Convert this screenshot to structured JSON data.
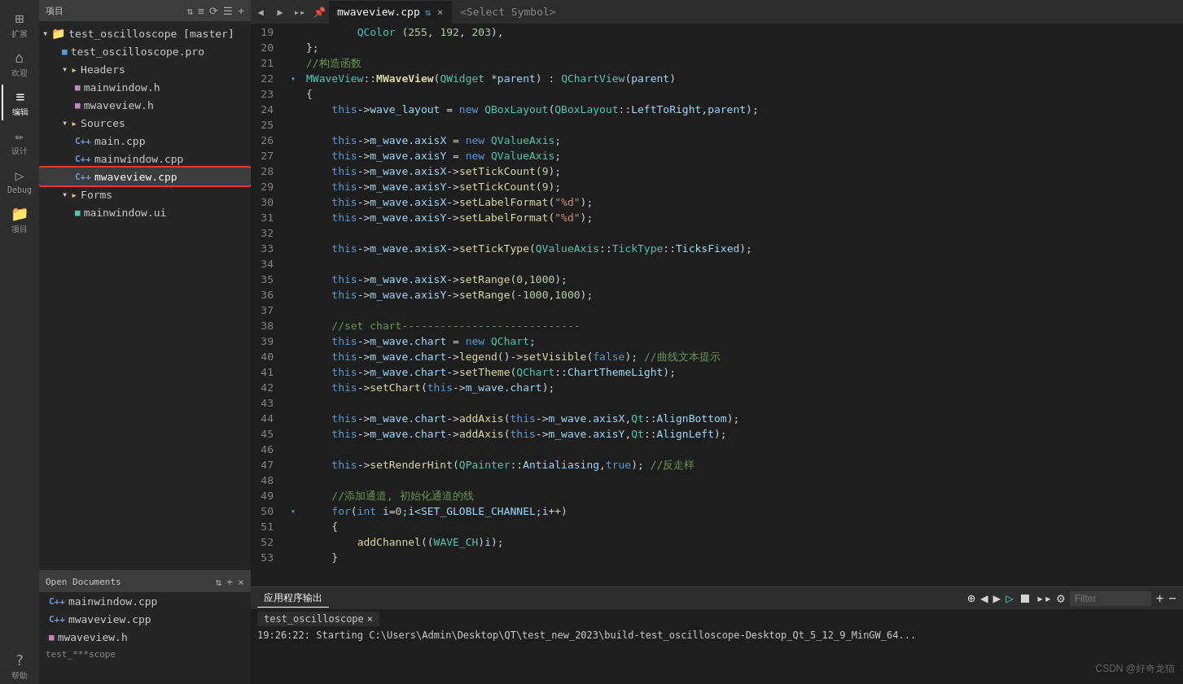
{
  "activityBar": {
    "items": [
      {
        "id": "extensions",
        "label": "扩展",
        "icon": "⊞"
      },
      {
        "id": "welcome",
        "label": "欢迎",
        "icon": "⌂"
      },
      {
        "id": "edit",
        "label": "编辑",
        "icon": "≡"
      },
      {
        "id": "design",
        "label": "设计",
        "icon": "✏"
      },
      {
        "id": "debug",
        "label": "Debug",
        "icon": "▷"
      },
      {
        "id": "project",
        "label": "项目",
        "icon": "📁"
      },
      {
        "id": "help",
        "label": "帮助",
        "icon": "?"
      }
    ]
  },
  "sidebar": {
    "header": {
      "title": "项目",
      "icons": [
        "⇅",
        "≡",
        "⟳",
        "☰",
        "+"
      ]
    },
    "tree": [
      {
        "id": "root",
        "label": "test_oscilloscope [master]",
        "indent": 0,
        "type": "root",
        "expanded": true
      },
      {
        "id": "pro",
        "label": "test_oscilloscope.pro",
        "indent": 1,
        "type": "pro"
      },
      {
        "id": "headers",
        "label": "Headers",
        "indent": 1,
        "type": "folder",
        "expanded": true
      },
      {
        "id": "mainwindow_h",
        "label": "mainwindow.h",
        "indent": 2,
        "type": "h"
      },
      {
        "id": "mwaveview_h",
        "label": "mwaveview.h",
        "indent": 2,
        "type": "h"
      },
      {
        "id": "sources",
        "label": "Sources",
        "indent": 1,
        "type": "folder",
        "expanded": true
      },
      {
        "id": "main_cpp",
        "label": "main.cpp",
        "indent": 2,
        "type": "cpp"
      },
      {
        "id": "mainwindow_cpp",
        "label": "mainwindow.cpp",
        "indent": 2,
        "type": "cpp"
      },
      {
        "id": "mwaveview_cpp",
        "label": "mwaveview.cpp",
        "indent": 2,
        "type": "cpp",
        "selected": true
      },
      {
        "id": "forms",
        "label": "Forms",
        "indent": 1,
        "type": "folder",
        "expanded": true
      },
      {
        "id": "mainwindow_ui",
        "label": "mainwindow.ui",
        "indent": 2,
        "type": "ui"
      }
    ]
  },
  "openDocuments": {
    "header": "Open Documents",
    "items": [
      {
        "label": "mainwindow.cpp"
      },
      {
        "label": "mwaveview.cpp"
      },
      {
        "label": "mwaveview.h"
      }
    ]
  },
  "sidebarBottom": {
    "text": "test_***scope"
  },
  "tabBar": {
    "navButtons": [
      "◀",
      "▶",
      "▸▸"
    ],
    "tabs": [
      {
        "label": "mwaveview.cpp",
        "active": true,
        "pinIcon": "📌"
      },
      {
        "label": "×",
        "isClose": true
      }
    ],
    "selectSymbol": "<Select Symbol>"
  },
  "code": {
    "lines": [
      {
        "num": 19,
        "gutter": "",
        "content": "        QColor (255, 192, 203),"
      },
      {
        "num": 20,
        "gutter": "",
        "content": "};"
      },
      {
        "num": 21,
        "gutter": "",
        "content": "//构造函数"
      },
      {
        "num": 22,
        "gutter": "▾",
        "content": "MWaveView::MWaveView(QWidget *parent) : QChartView(parent)"
      },
      {
        "num": 23,
        "gutter": "",
        "content": "{"
      },
      {
        "num": 24,
        "gutter": "",
        "content": "    this->wave_layout = new QBoxLayout(QBoxLayout::LeftToRight,parent);"
      },
      {
        "num": 25,
        "gutter": "",
        "content": ""
      },
      {
        "num": 26,
        "gutter": "",
        "content": "    this->m_wave.axisX = new QValueAxis;"
      },
      {
        "num": 27,
        "gutter": "",
        "content": "    this->m_wave.axisY = new QValueAxis;"
      },
      {
        "num": 28,
        "gutter": "",
        "content": "    this->m_wave.axisX->setTickCount(9);"
      },
      {
        "num": 29,
        "gutter": "",
        "content": "    this->m_wave.axisY->setTickCount(9);"
      },
      {
        "num": 30,
        "gutter": "",
        "content": "    this->m_wave.axisX->setLabelFormat(\"%d\");"
      },
      {
        "num": 31,
        "gutter": "",
        "content": "    this->m_wave.axisY->setLabelFormat(\"%d\");"
      },
      {
        "num": 32,
        "gutter": "",
        "content": ""
      },
      {
        "num": 33,
        "gutter": "",
        "content": "    this->m_wave.axisX->setTickType(QValueAxis::TickType::TicksFixed);"
      },
      {
        "num": 34,
        "gutter": "",
        "content": ""
      },
      {
        "num": 35,
        "gutter": "",
        "content": "    this->m_wave.axisX->setRange(0,1000);"
      },
      {
        "num": 36,
        "gutter": "",
        "content": "    this->m_wave.axisY->setRange(-1000,1000);"
      },
      {
        "num": 37,
        "gutter": "",
        "content": ""
      },
      {
        "num": 38,
        "gutter": "",
        "content": "    //set chart----------------------------"
      },
      {
        "num": 39,
        "gutter": "",
        "content": "    this->m_wave.chart = new QChart;"
      },
      {
        "num": 40,
        "gutter": "",
        "content": "    this->m_wave.chart->legend()->setVisible(false); //曲线文本提示"
      },
      {
        "num": 41,
        "gutter": "",
        "content": "    this->m_wave.chart->setTheme(QChart::ChartThemeLight);"
      },
      {
        "num": 42,
        "gutter": "",
        "content": "    this->setChart(this->m_wave.chart);"
      },
      {
        "num": 43,
        "gutter": "",
        "content": ""
      },
      {
        "num": 44,
        "gutter": "",
        "content": "    this->m_wave.chart->addAxis(this->m_wave.axisX,Qt::AlignBottom);"
      },
      {
        "num": 45,
        "gutter": "",
        "content": "    this->m_wave.chart->addAxis(this->m_wave.axisY,Qt::AlignLeft);"
      },
      {
        "num": 46,
        "gutter": "",
        "content": ""
      },
      {
        "num": 47,
        "gutter": "",
        "content": "    this->setRenderHint(QPainter::Antialiasing,true); //反走样"
      },
      {
        "num": 48,
        "gutter": "",
        "content": ""
      },
      {
        "num": 49,
        "gutter": "",
        "content": "    //添加通道, 初始化通道的线"
      },
      {
        "num": 50,
        "gutter": "▾",
        "content": "    for(int i=0;i<SET_GLOBLE_CHANNEL;i++)"
      },
      {
        "num": 51,
        "gutter": "",
        "content": "    {"
      },
      {
        "num": 52,
        "gutter": "",
        "content": "        addChannel((WAVE_CH)i);"
      },
      {
        "num": 53,
        "gutter": "",
        "content": "    }"
      }
    ]
  },
  "bottomPanel": {
    "tabs": [
      {
        "label": "应用程序输出",
        "active": true
      }
    ],
    "toolbar": {
      "icons": [
        "⊕",
        "◀",
        "▶",
        "▷",
        "⏹",
        "▸▸",
        "⚙"
      ],
      "filterPlaceholder": "Filter",
      "addBtn": "+",
      "removeBtn": "−"
    },
    "appTabs": [
      {
        "label": "test_oscilloscope",
        "closeIcon": "×"
      }
    ],
    "outputText": "19:26:22: Starting C:\\Users\\Admin\\Desktop\\QT\\test_new_2023\\build-test_oscilloscope-Desktop_Qt_5_12_9_MinGW_64..."
  },
  "watermark": "CSDN @好奇龙猫"
}
